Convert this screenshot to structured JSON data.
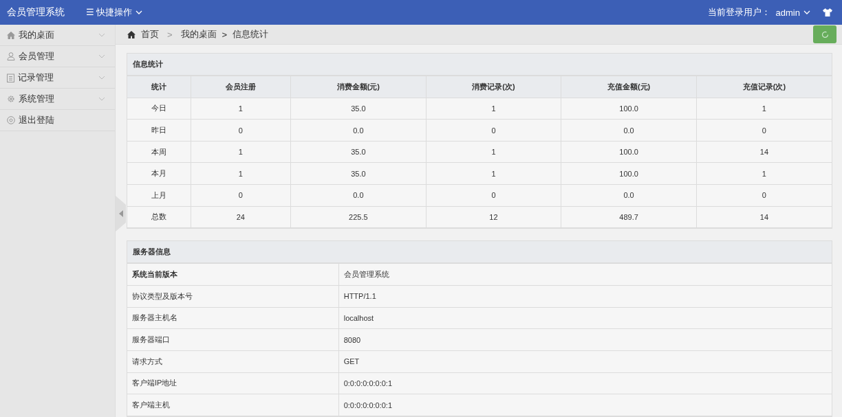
{
  "header": {
    "title": "会员管理系统",
    "quick_menu": {
      "icon": "☰",
      "label": "快捷操作"
    },
    "user_label": "当前登录用户：",
    "user": "admin"
  },
  "sidebar": {
    "items": [
      {
        "label": "我的桌面",
        "kind": "menu"
      },
      {
        "label": "会员管理",
        "kind": "menu"
      },
      {
        "label": "记录管理",
        "kind": "menu"
      },
      {
        "label": "系统管理",
        "kind": "menu"
      },
      {
        "label": "退出登陆",
        "kind": "link"
      }
    ]
  },
  "breadcrumb": {
    "items": [
      "首页",
      "我的桌面",
      "信息统计"
    ],
    "separators": [
      ">",
      ">"
    ]
  },
  "stats": {
    "title": "信息统计",
    "columns": [
      "统计",
      "会员注册",
      "消费金额(元)",
      "消费记录(次)",
      "充值金额(元)",
      "充值记录(次)"
    ],
    "rows": [
      [
        "今日",
        "1",
        "35.0",
        "1",
        "100.0",
        "1"
      ],
      [
        "昨日",
        "0",
        "0.0",
        "0",
        "0.0",
        "0"
      ],
      [
        "本周",
        "1",
        "35.0",
        "1",
        "100.0",
        "14"
      ],
      [
        "本月",
        "1",
        "35.0",
        "1",
        "100.0",
        "1"
      ],
      [
        "上月",
        "0",
        "0.0",
        "0",
        "0.0",
        "0"
      ],
      [
        "总数",
        "24",
        "225.5",
        "12",
        "489.7",
        "14"
      ]
    ]
  },
  "server": {
    "title": "服务器信息",
    "rows": [
      {
        "key": "系统当前版本",
        "value": "会员管理系统",
        "bold": true
      },
      {
        "key": "协议类型及版本号",
        "value": "HTTP/1.1",
        "bold": false
      },
      {
        "key": "服务器主机名",
        "value": "localhost",
        "bold": false
      },
      {
        "key": "服务器端口",
        "value": "8080",
        "bold": false
      },
      {
        "key": "请求方式",
        "value": "GET",
        "bold": false
      },
      {
        "key": "客户端IP地址",
        "value": "0:0:0:0:0:0:0:1",
        "bold": false
      },
      {
        "key": "客户端主机",
        "value": "0:0:0:0:0:0:0:1",
        "bold": false
      }
    ]
  }
}
